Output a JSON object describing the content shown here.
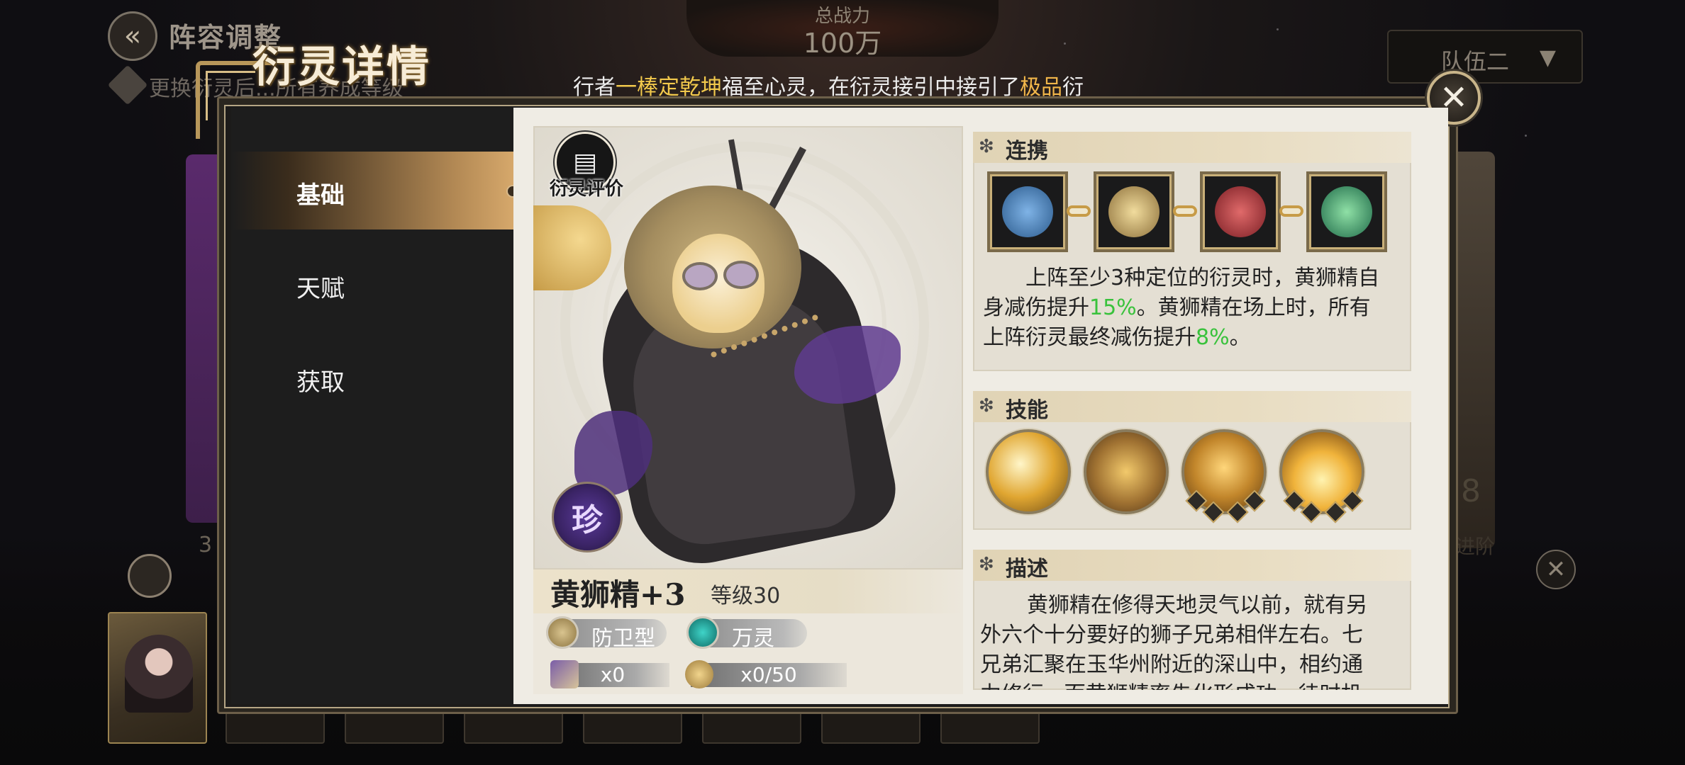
{
  "background": {
    "back_title": "阵容调整",
    "hint_text": "更换衍灵后...所有养成等级",
    "power_label": "总战力",
    "power_value": "100万",
    "team_select": "队伍二",
    "side_left_number": "3",
    "side_right_number": "8",
    "side_right_small": "进阶"
  },
  "marquee": {
    "part1": "行者",
    "highlight1": "一棒定乾坤",
    "part2": "福至心灵，在衍灵接引中接引了",
    "highlight2": "极品",
    "part3": "衍"
  },
  "modal": {
    "title": "衍灵详情",
    "close_symbol": "✕"
  },
  "nav": {
    "items": [
      {
        "label": "基础"
      },
      {
        "label": "天赋"
      },
      {
        "label": "获取"
      }
    ]
  },
  "character": {
    "eval_label": "衍灵评价",
    "rarity": "珍",
    "name": "黄狮精+3",
    "level": "等级30",
    "tags": [
      {
        "label": "防卫型",
        "icon": "shield-icon"
      },
      {
        "label": "万灵",
        "icon": "spirit-icon"
      }
    ],
    "resources": [
      {
        "value": "x0",
        "icon": "shard-icon"
      },
      {
        "value": "x0/50",
        "icon": "token-icon"
      }
    ]
  },
  "sections": {
    "link": {
      "title": "连携",
      "icons": [
        "blue-arrow-icon",
        "gold-shield-icon",
        "red-blade-icon",
        "green-swirl-icon"
      ],
      "text_a": "上阵至少3种定位的衍灵时，黄狮精自",
      "text_b": "身减伤提升",
      "val1": "15%",
      "text_c": "。黄狮精在场上时，所有",
      "text_d": "上阵衍灵最终减伤提升",
      "val2": "8%",
      "text_e": "。"
    },
    "skills": {
      "title": "技能",
      "icons": [
        "golden-strike-icon",
        "warrior-leap-icon",
        "lion-roar-icon",
        "flame-burst-icon"
      ]
    },
    "description": {
      "title": "描述",
      "line1": "黄狮精在修得天地灵气以前，就有另",
      "line2": "外六个十分要好的狮子兄弟相伴左右。七",
      "line3": "兄弟汇聚在玉华州附近的深山中，相约通",
      "line4": "力修行...而黄狮精率先化形成功，待时机"
    }
  },
  "colors": {
    "accent_gold": "#c9b58a",
    "highlight_yellow": "#f2c94c",
    "green_value": "#39c23c",
    "rare_purple": "#5a3a9a"
  }
}
